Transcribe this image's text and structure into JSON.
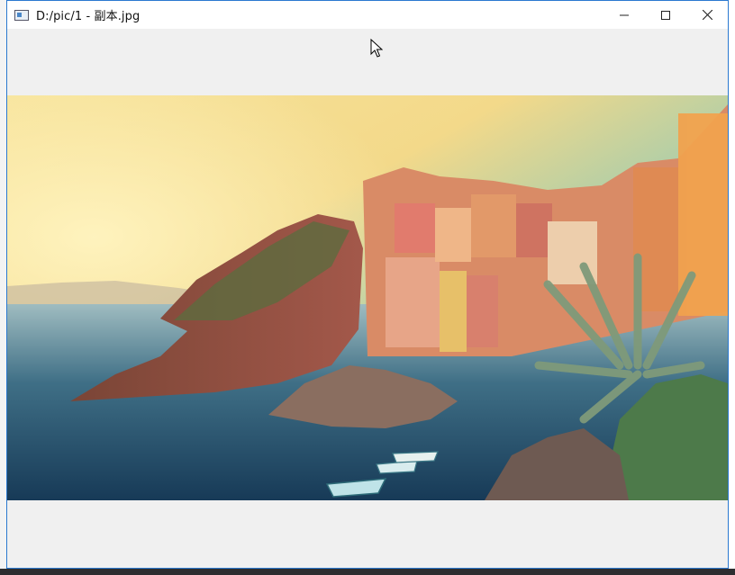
{
  "window": {
    "title": "D:/pic/1 - 副本.jpg",
    "controls": {
      "minimize": "minimize",
      "maximize": "maximize",
      "close": "close"
    }
  },
  "viewer": {
    "image_description_icon": "landscape-photo"
  },
  "colors": {
    "window_border": "#2b79d0",
    "client_bg": "#f0f0f0",
    "titlebar_bg": "#ffffff"
  }
}
